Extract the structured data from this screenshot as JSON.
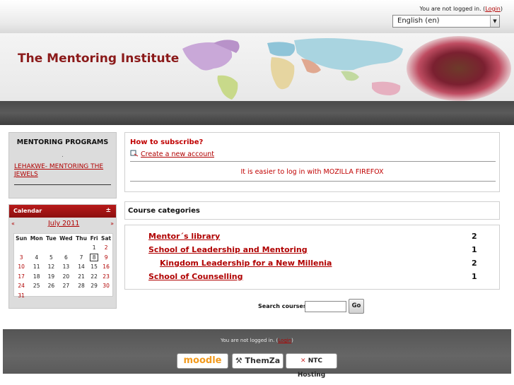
{
  "top": {
    "not_logged": "You are not logged in. (",
    "login_link": "Login",
    "close_paren": ")",
    "language": "English (en)"
  },
  "header": {
    "site_title": "The Mentoring Institute"
  },
  "mentoring": {
    "title": "MENTORING PROGRAMS",
    "dot": ".",
    "link": "LEHAKWE- MENTORING THE JEWELS"
  },
  "calendar": {
    "title": "Calendar",
    "toggle": "±",
    "prev": "«",
    "month": "July 2011",
    "next": "»",
    "days": [
      "Sun",
      "Mon",
      "Tue",
      "Wed",
      "Thu",
      "Fri",
      "Sat"
    ],
    "weeks": [
      [
        "",
        "",
        "",
        "",
        "",
        "1",
        "2"
      ],
      [
        "3",
        "4",
        "5",
        "6",
        "7",
        "8",
        "9"
      ],
      [
        "10",
        "11",
        "12",
        "13",
        "14",
        "15",
        "16"
      ],
      [
        "17",
        "18",
        "19",
        "20",
        "21",
        "22",
        "23"
      ],
      [
        "24",
        "25",
        "26",
        "27",
        "28",
        "29",
        "30"
      ],
      [
        "31",
        "",
        "",
        "",
        "",
        "",
        ""
      ]
    ],
    "today": "8"
  },
  "subscribe": {
    "title": "How to subscribe?",
    "create_link": "Create a new account",
    "firefox_msg": "It is easier to log in with MOZILLA FIREFOX"
  },
  "categories": {
    "heading": "Course categories",
    "items": [
      {
        "name": "Mentor´s library",
        "count": "2",
        "indent": 0
      },
      {
        "name": "School of Leadership and Mentoring",
        "count": "1",
        "indent": 0
      },
      {
        "name": "Kingdom Leadership for a New Millenia",
        "count": "2",
        "indent": 1
      },
      {
        "name": "School of Counselling",
        "count": "1",
        "indent": 0
      }
    ]
  },
  "search": {
    "label": "Search courses:",
    "value": "",
    "button": "Go"
  },
  "footer": {
    "not_logged": "You are not logged in. (",
    "login_link": "Login",
    "close_paren": ")",
    "badges": [
      "moodle",
      "ThemZa",
      "NTC Hosting"
    ]
  }
}
